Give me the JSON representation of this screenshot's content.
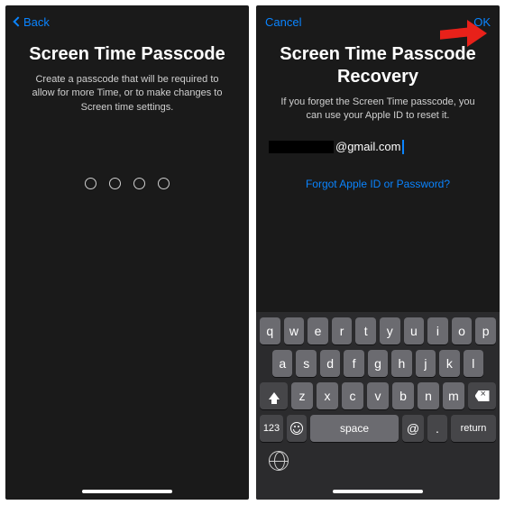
{
  "left": {
    "back": "Back",
    "title": "Screen Time Passcode",
    "subtitle": "Create a passcode that will be required to allow for more Time, or to make changes to Screen time settings."
  },
  "right": {
    "cancel": "Cancel",
    "ok": "OK",
    "title": "Screen Time Passcode Recovery",
    "subtitle": "If you forget the Screen Time passcode, you can use your Apple ID to reset it.",
    "email_visible": "@gmail.com",
    "forgot": "Forgot Apple ID or Password?"
  },
  "kb": {
    "r1": [
      "q",
      "w",
      "e",
      "r",
      "t",
      "y",
      "u",
      "i",
      "o",
      "p"
    ],
    "r2": [
      "a",
      "s",
      "d",
      "f",
      "g",
      "h",
      "j",
      "k",
      "l"
    ],
    "r3": [
      "z",
      "x",
      "c",
      "v",
      "b",
      "n",
      "m"
    ],
    "num": "123",
    "space": "space",
    "at": "@",
    "dot": ".",
    "ret": "return"
  }
}
